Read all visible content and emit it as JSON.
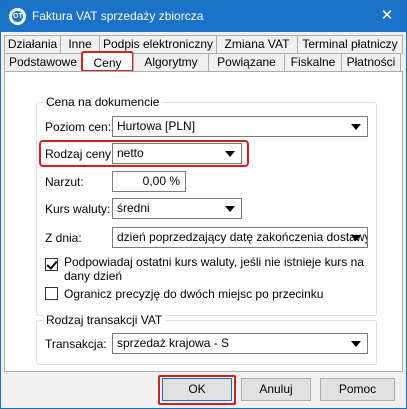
{
  "window": {
    "title": "Faktura VAT sprzedaży zbiorcza",
    "close_glyph": "✕",
    "app_icon_text": "OT"
  },
  "tabs_top": [
    "Działania",
    "Inne",
    "Podpis elektroniczny",
    "Zmiana VAT",
    "Terminal płatniczy"
  ],
  "tabs_bottom": [
    "Podstawowe",
    "Ceny",
    "Algorytmy",
    "Powiązane",
    "Fiskalne",
    "Płatności"
  ],
  "active_tab": "Ceny",
  "price_group": {
    "legend": "Cena na dokumencie",
    "price_level_label": "Poziom cen:",
    "price_level_value": "Hurtowa [PLN]",
    "price_type_label": "Rodzaj ceny:",
    "price_type_value": "netto",
    "markup_label": "Narzut:",
    "markup_value": "0,00 %",
    "exchange_rate_label": "Kurs waluty:",
    "exchange_rate_value": "średni",
    "from_day_label": "Z dnia:",
    "from_day_value": "dzień poprzedzający datę zakończenia dostawy",
    "suggest_rate_label": "Podpowiadaj ostatni kurs waluty, jeśli nie istnieje kurs na dany dzień",
    "suggest_rate_checked": true,
    "limit_precision_label": "Ogranicz precyzję do dwóch miejsc po przecinku",
    "limit_precision_checked": false
  },
  "vat_group": {
    "legend": "Rodzaj transakcji VAT",
    "transaction_label": "Transakcja:",
    "transaction_value": "sprzedaż krajowa - S"
  },
  "buttons": {
    "ok": "OK",
    "cancel": "Anuluj",
    "help": "Pomoc"
  },
  "colors": {
    "titlebar": "#1a73c8",
    "highlight": "#d62020"
  }
}
